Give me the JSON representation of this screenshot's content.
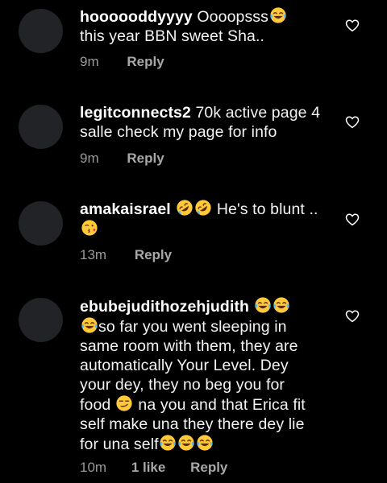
{
  "comments": [
    {
      "username": "hoooooddyyyy",
      "text_parts": [
        "Oooopsss",
        "this year BBN sweet Sha.."
      ],
      "time": "9m",
      "reply_label": "Reply"
    },
    {
      "username": "legitconnects2",
      "text_parts": [
        "70k active page 4",
        "salle check my page for info"
      ],
      "time": "9m",
      "reply_label": "Reply"
    },
    {
      "username": "amakaisrael",
      "text_parts": [
        "He's to blunt .."
      ],
      "time": "13m",
      "reply_label": "Reply"
    },
    {
      "username": "ebubejudithozehjudith",
      "text_parts": [
        "so far you went sleeping in",
        "same room with them, they are",
        "automatically Your Level. Dey",
        "your dey, they no beg you for",
        "food",
        "na you and that Erica fit",
        "self make una they there dey lie",
        "for una self"
      ],
      "time": "10m",
      "likes": "1 like",
      "reply_label": "Reply"
    }
  ],
  "icons": {
    "laugh": "face-with-tears-of-joy",
    "rofl": "rolling-on-the-floor-laughing",
    "kiss": "face-blowing-a-kiss",
    "smirk": "smirking-face",
    "heart": "heart-outline"
  },
  "colors": {
    "background": "#000000",
    "text": "#f3f3f3",
    "meta": "#9a9a9a",
    "avatar": "#222326"
  }
}
